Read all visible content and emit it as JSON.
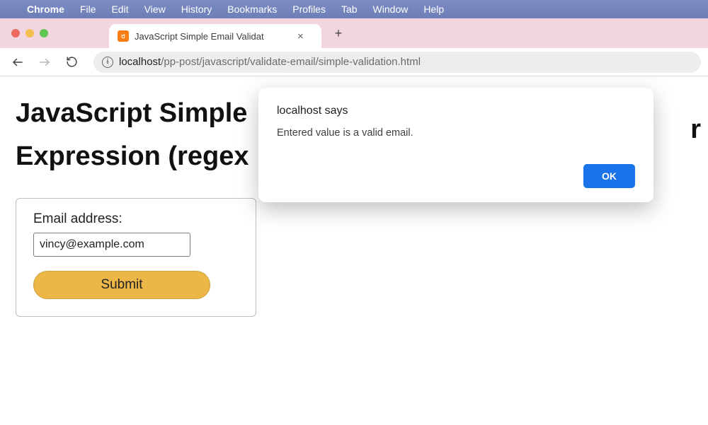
{
  "menubar": {
    "apple_glyph": "",
    "app": "Chrome",
    "items": [
      "File",
      "Edit",
      "View",
      "History",
      "Bookmarks",
      "Profiles",
      "Tab",
      "Window",
      "Help"
    ]
  },
  "tabstrip": {
    "tab_title": "JavaScript Simple Email Validat",
    "favicon_letter": "ರ",
    "close_glyph": "×",
    "newtab_glyph": "+"
  },
  "toolbar": {
    "back_glyph": "←",
    "forward_glyph": "→",
    "reload_glyph": "↻",
    "info_glyph": "i",
    "url_host": "localhost",
    "url_path": "/pp-post/javascript/validate-email/simple-validation.html"
  },
  "page": {
    "title_line1": "JavaScript Simple",
    "title_line2": "Expression (regex",
    "title_trail": "r",
    "form": {
      "label": "Email address:",
      "value": "vincy@example.com",
      "submit_label": "Submit"
    }
  },
  "alert": {
    "origin": "localhost says",
    "message": "Entered value is a valid email.",
    "ok_label": "OK"
  }
}
